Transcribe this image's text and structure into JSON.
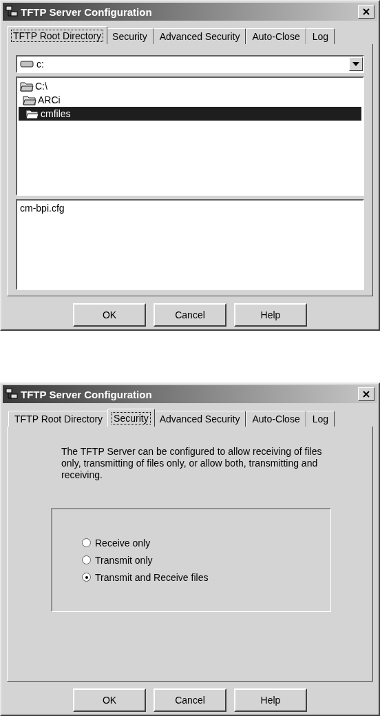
{
  "dialogs": [
    {
      "kind": "directory",
      "title": "TFTP Server Configuration",
      "tabs": [
        {
          "label": "TFTP Root Directory",
          "selected": true
        },
        {
          "label": "Security",
          "selected": false
        },
        {
          "label": "Advanced Security",
          "selected": false
        },
        {
          "label": "Auto-Close",
          "selected": false
        },
        {
          "label": "Log",
          "selected": false
        }
      ],
      "drive": {
        "value": "c:"
      },
      "tree": [
        {
          "label": "C:\\",
          "selected": false,
          "children": [
            {
              "label": "ARCi",
              "selected": false,
              "children": [
                {
                  "label": "cmfiles",
                  "selected": true
                }
              ]
            }
          ]
        }
      ],
      "files": [
        "cm-bpi.cfg"
      ],
      "buttons": [
        "OK",
        "Cancel",
        "Help"
      ]
    },
    {
      "kind": "security",
      "title": "TFTP Server Configuration",
      "tabs": [
        {
          "label": "TFTP Root Directory",
          "selected": false
        },
        {
          "label": "Security",
          "selected": true
        },
        {
          "label": "Advanced Security",
          "selected": false
        },
        {
          "label": "Auto-Close",
          "selected": false
        },
        {
          "label": "Log",
          "selected": false
        }
      ],
      "description": "The TFTP Server can be configured to allow receiving of files only, transmitting of files only, or allow both, transmitting and receiving.",
      "options": [
        {
          "label": "Receive only",
          "selected": false
        },
        {
          "label": "Transmit only",
          "selected": false
        },
        {
          "label": "Transmit and Receive files",
          "selected": true
        }
      ],
      "buttons": [
        "OK",
        "Cancel",
        "Help"
      ]
    }
  ]
}
